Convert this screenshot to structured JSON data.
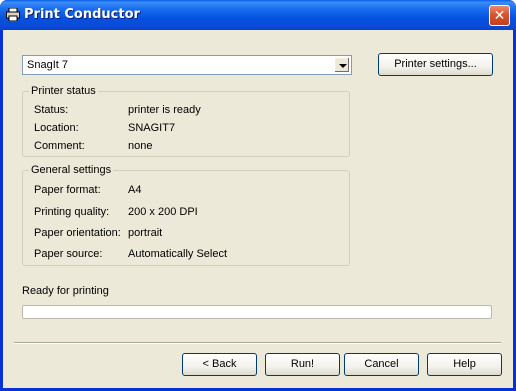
{
  "window": {
    "title": "Print Conductor"
  },
  "printer": {
    "selected": "SnagIt 7",
    "settings_button": "Printer settings..."
  },
  "printer_status": {
    "heading": "Printer status",
    "rows": [
      {
        "label": "Status:",
        "value": "printer is ready"
      },
      {
        "label": "Location:",
        "value": "SNAGIT7"
      },
      {
        "label": "Comment:",
        "value": "none"
      }
    ]
  },
  "general_settings": {
    "heading": "General settings",
    "rows": [
      {
        "label": "Paper format:",
        "value": "A4"
      },
      {
        "label": "Printing quality:",
        "value": "200 x 200 DPI"
      },
      {
        "label": "Paper orientation:",
        "value": "portrait"
      },
      {
        "label": "Paper source:",
        "value": "Automatically Select"
      }
    ]
  },
  "status": {
    "text": "Ready for printing",
    "progress_fraction": 0
  },
  "footer": {
    "back": "< Back",
    "run": "Run!",
    "cancel": "Cancel",
    "help": "Help"
  },
  "icons": {
    "title": "printer-icon",
    "close": "close-icon",
    "dropdown": "chevron-down-icon"
  }
}
